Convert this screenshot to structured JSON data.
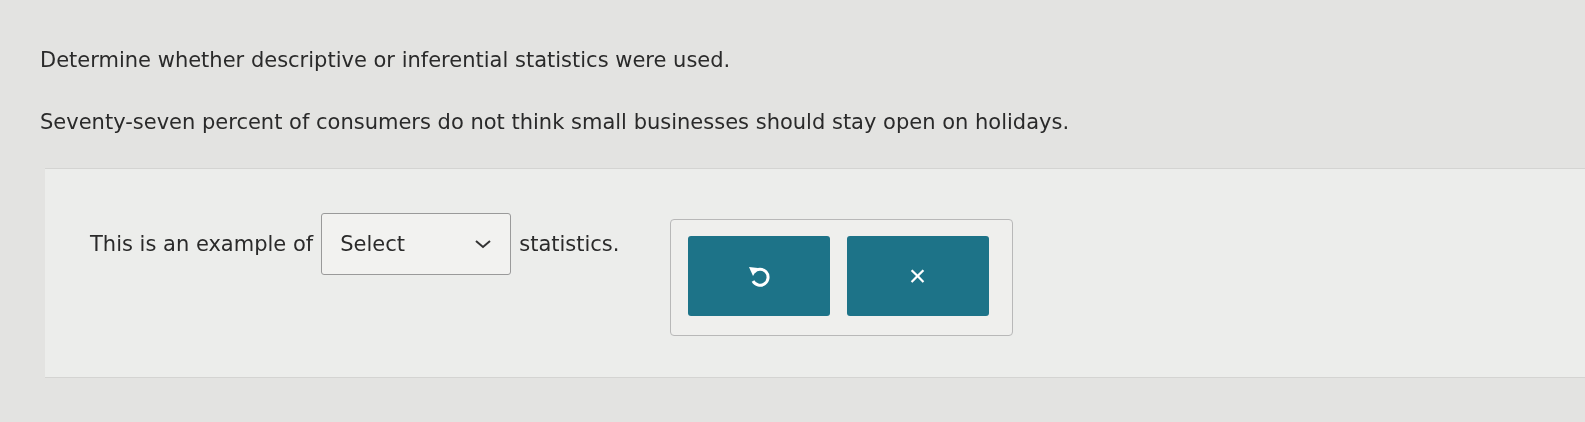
{
  "instruction": "Determine whether descriptive or inferential statistics were used.",
  "statement": "Seventy-seven percent of consumers do not think small businesses should stay open on holidays.",
  "answer": {
    "before": "This is an example of",
    "dropdown": {
      "value": "Select"
    },
    "after": "statistics."
  },
  "actions": [
    {
      "kind": "undo"
    },
    {
      "kind": "clear",
      "label": "×"
    }
  ]
}
